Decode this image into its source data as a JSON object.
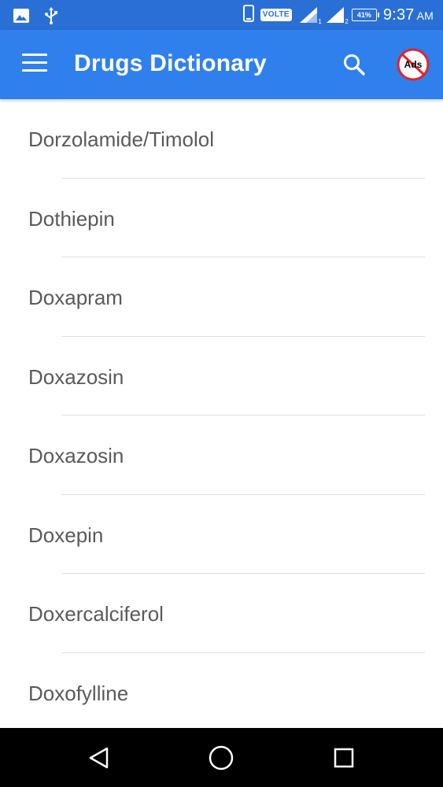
{
  "status_bar": {
    "volte": "VOLTE",
    "sim1": "1",
    "sim2": "2",
    "battery": "41%",
    "time": "9:37",
    "ampm": "AM"
  },
  "app_bar": {
    "title": "Drugs Dictionary",
    "color": "#2f80ed"
  },
  "noads": {
    "label": "Ads"
  },
  "drugs": [
    "Dorzolamide/Timolol",
    "Dothiepin",
    "Doxapram",
    "Doxazosin",
    "Doxazosin",
    "Doxepin",
    "Doxercalciferol",
    "Doxofylline"
  ]
}
